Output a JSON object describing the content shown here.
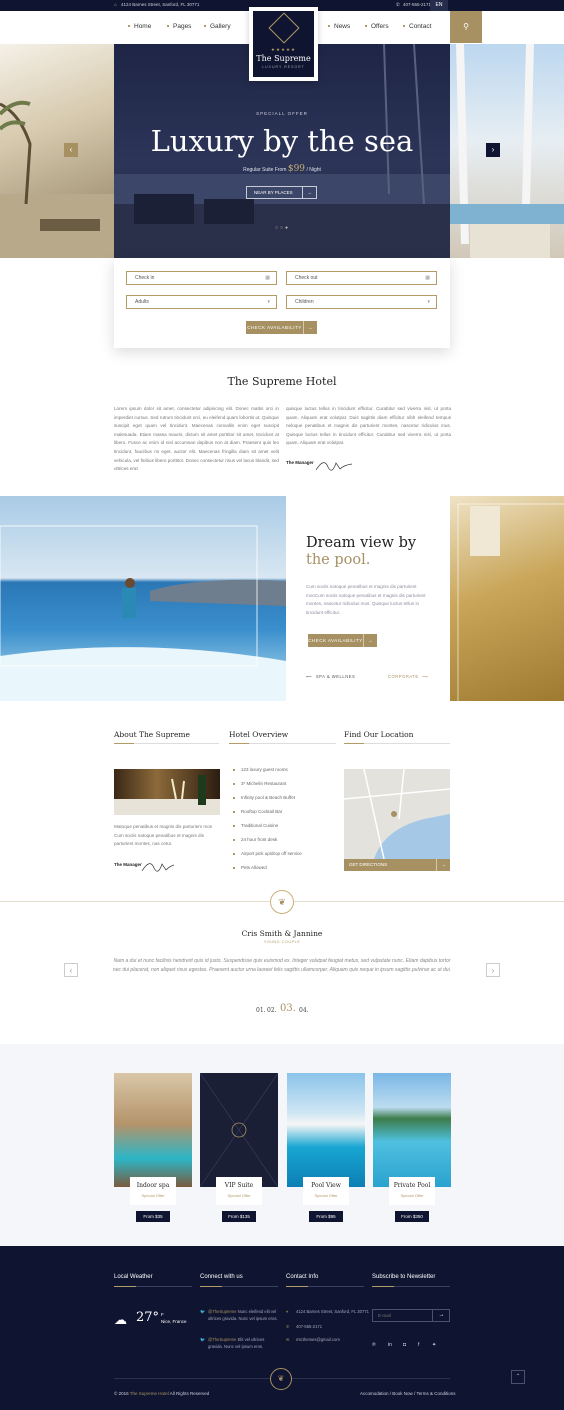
{
  "topbar": {
    "address": "4124 Barnes Street, Sanford, FL 30771",
    "phone": "407-555-2171",
    "lang": "EN"
  },
  "nav": {
    "home": "Home",
    "pages": "Pages",
    "gallery": "Gallery",
    "news": "News",
    "offers": "Offers",
    "contact": "Contact"
  },
  "logo": {
    "stars": "★★★★★",
    "name": "The Supreme",
    "tagline": "LUXURY RESORT"
  },
  "hero": {
    "kicker": "SPECIALL OFFER",
    "title": "Luxury by the sea",
    "price_prefix": "Regular Suite From",
    "price": "$99",
    "price_suffix": "/ Night",
    "button": "NEAR BY PLACES"
  },
  "booking": {
    "checkin": "Check in",
    "checkout": "Check out",
    "adults": "Adults",
    "children": "Children",
    "button": "CHECK AVAILABILITY"
  },
  "intro": {
    "title": "The Supreme Hotel",
    "col1": "Lorem ipsum dolor sit amet, consectetur adipiscing elit. Donec mattis orci in imperdiet cursus. Sed rutrum tincidunt orci, eu eleifend quam lobortis ut. Quisque suscipit eget quam vel tincidunt. Maecenas convallis enim eget suscipit malesuada. Etiam massa mauris, dictum sit amet porttitor sit amet, tincidunt at libero. Fusce ac enim id nisl accumsan dapibus non at diam. Praesent quis leo tincidunt, faucibus mi eget, auctor elit. Maecenas fringilla diam sit amet velit vehicula, vel finibus libero porttitor. Donec consectetur risus vel lacus blandit, sed ultrices erat",
    "col2": "quisque luctus tellus in tincidunt efficitur. Curabitur sed viverra nisl, ut porta quam. Aliquam erat volutpat. Duis sagittis diam efficitur nibh eleifend tempus neloque penatibus et magnis dis parturient montes, nascetur ridiculus mus. Quisque luctus tellus in tincidunt efficitur. Curabitur sed viverra nisl, ut porta quam. Aliquam erat volutpat.",
    "signature_label": "The Manager"
  },
  "pool": {
    "title_line1": "Dream view by",
    "title_line2": "the pool.",
    "text": "Cum sociis natoque penatibus et magnis dis parturient monCum sociis natoque penatibus et magnis dis parturient montes, nascetur ridiculus mus. Quisque luctus tellus in tincidunt efficitur.",
    "button": "CHECK AVAILABILITY",
    "prev": "SPA & WELLNES",
    "next": "CORPORATE"
  },
  "about": {
    "title": "About The Supreme",
    "text": "Matoque penatibus et magnis dis parturiem mon Cum sociis natoque penatibus et magnis dis parturient montes, nas cetur.",
    "signature_label": "The Manager"
  },
  "overview": {
    "title": "Hotel Overview",
    "items": [
      "123 luxury guest rooms",
      "3* Michelin Restaurant",
      "Infinity pool & Beach Buffet",
      "Rooftop Cocktail Bar",
      "Traditional Cuisine",
      "24 hour front desk",
      "Airport pick up/drop off service",
      "Pets Allowed"
    ]
  },
  "location": {
    "title": "Find Our Location",
    "button": "GET DIRECTIONS"
  },
  "testimonial": {
    "name": "Cris Smith & Jannine",
    "role": "YOUNG COUPLE",
    "quote": "Nam a dui et nunc facilisis hendrerit quis id justo. Suspendisse quis euismod ex. Integer volutpat feugiat metus, sed vulputate nunc. Etiam dapibus tortor nec dui placerat, non aliquet risus egestas. Praesent auctor urna laoreet felis sagittis ullamcorper. Aliquam quis neque in ipsum sagittis pulvinar ac ut dui.",
    "pages": [
      "01.",
      "02.",
      "03.",
      "04."
    ]
  },
  "rooms": [
    {
      "name": "Indoor spa",
      "tag": "Special Offer",
      "price": "From $35"
    },
    {
      "name": "VIP Suite",
      "tag": "Special Offer",
      "price": "From $135"
    },
    {
      "name": "Pool View",
      "tag": "Special Offer",
      "price": "From $95"
    },
    {
      "name": "Private Pool",
      "tag": "Special Offer",
      "price": "From $350"
    }
  ],
  "footer": {
    "weather_title": "Local Weather",
    "temp": "27°",
    "unit": "F",
    "city": "Nice, France",
    "connect_title": "Connect with us",
    "tweet1_handle": "@TheSupreme",
    "tweet1_text": "Nunc eleifend elit vel ultrices gravida. Nunc vel ipsum eros.",
    "tweet2_handle": "@TheSupreme",
    "tweet2_text": "Elit vel ultrices gravida. Nunc vel ipsum eros.",
    "contact_title": "Contact Info",
    "address": "4124 Barnes Street, Sanford, FL 30771",
    "phone": "407-555-2171",
    "email": "mtcthemes@gmail.com",
    "news_title": "Subscribe to Newsletter",
    "email_placeholder": "E-mail",
    "copyright": "© 2016",
    "brand": "The Supreme Hotel",
    "rights": "All Rights Reserved",
    "links": [
      "Accomodation",
      "Book Now",
      "Terms & Conditions"
    ]
  },
  "colors": {
    "navy": "#0f1430",
    "gold": "#a79163"
  }
}
